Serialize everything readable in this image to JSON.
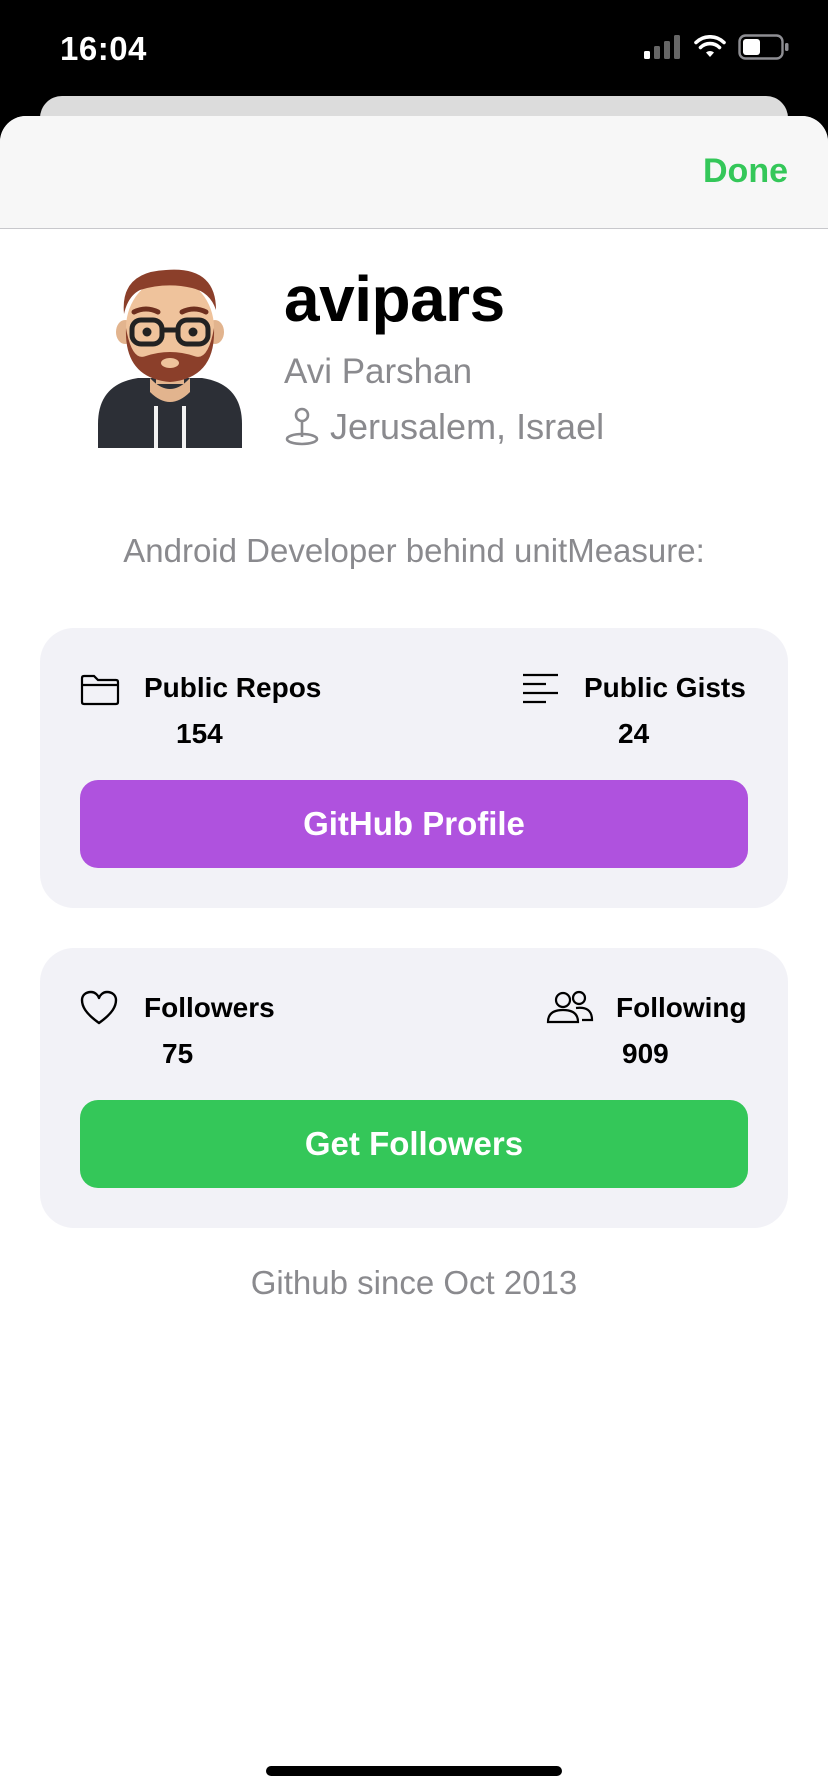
{
  "status_bar": {
    "time": "16:04",
    "icons": [
      "cellular-signal-icon",
      "wifi-icon",
      "battery-icon"
    ]
  },
  "nav": {
    "done_label": "Done"
  },
  "profile": {
    "username": "avipars",
    "full_name": "Avi Parshan",
    "location": "Jerusalem, Israel",
    "bio": "Android Developer behind unitMeasure:"
  },
  "repo_card": {
    "public_repos_label": "Public Repos",
    "public_repos_value": "154",
    "public_gists_label": "Public Gists",
    "public_gists_value": "24",
    "button_label": "GitHub Profile"
  },
  "followers_card": {
    "followers_label": "Followers",
    "followers_value": "75",
    "following_label": "Following",
    "following_value": "909",
    "button_label": "Get Followers"
  },
  "footer": {
    "since": "Github since Oct 2013"
  },
  "colors": {
    "accent_green": "#34c759",
    "accent_purple": "#af52de",
    "secondary_text": "#8a8a8e",
    "card_bg": "#f2f2f7"
  }
}
